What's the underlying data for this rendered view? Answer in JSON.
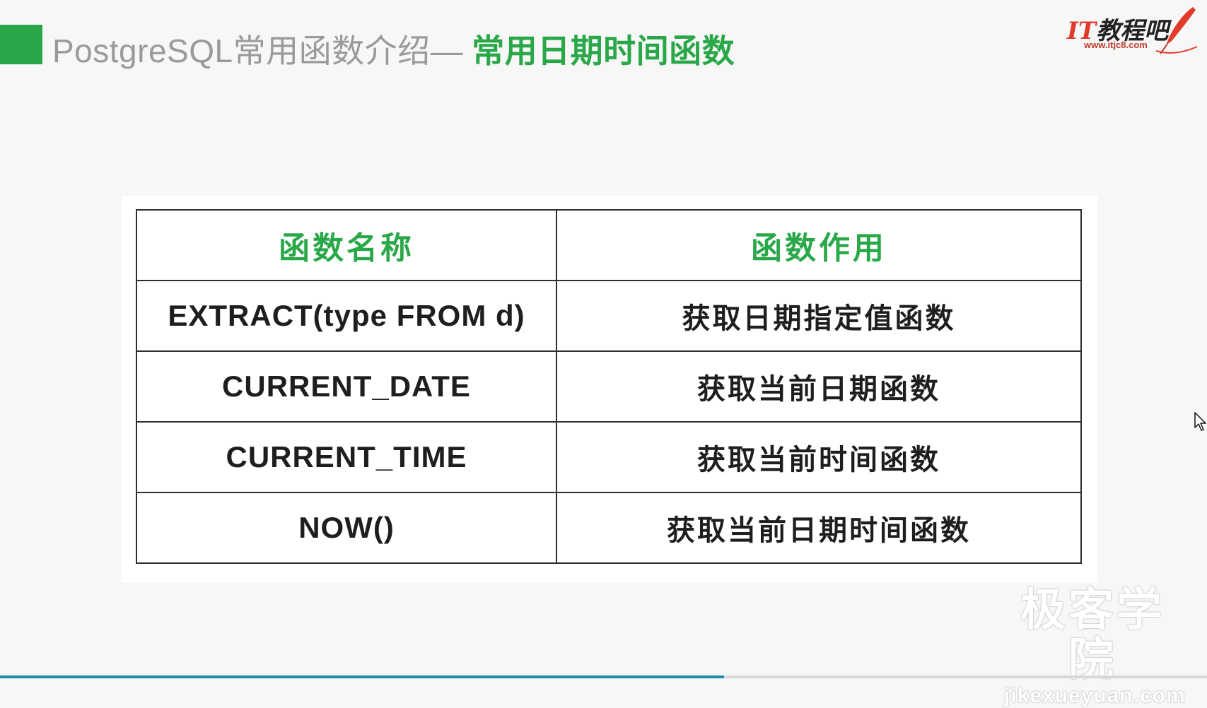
{
  "header": {
    "title_prefix": "PostgreSQL常用函数介绍—",
    "title_highlight": "常用日期时间函数",
    "accent_color": "#2aa849"
  },
  "logo": {
    "text_it": "IT",
    "text_cn": "教程吧",
    "url": "www.itjc8.com",
    "icon": "quill-pen-icon"
  },
  "table": {
    "headers": [
      "函数名称",
      "函数作用"
    ],
    "rows": [
      {
        "name": "EXTRACT(type FROM d)",
        "desc": "获取日期指定值函数"
      },
      {
        "name": "CURRENT_DATE",
        "desc": "获取当前日期函数"
      },
      {
        "name": "CURRENT_TIME",
        "desc": "获取当前时间函数"
      },
      {
        "name": "NOW()",
        "desc": "获取当前日期时间函数"
      }
    ]
  },
  "watermark": {
    "cn": "极客学院",
    "en": "jikexueyuan.com"
  },
  "playback": {
    "progress": 0.6
  }
}
